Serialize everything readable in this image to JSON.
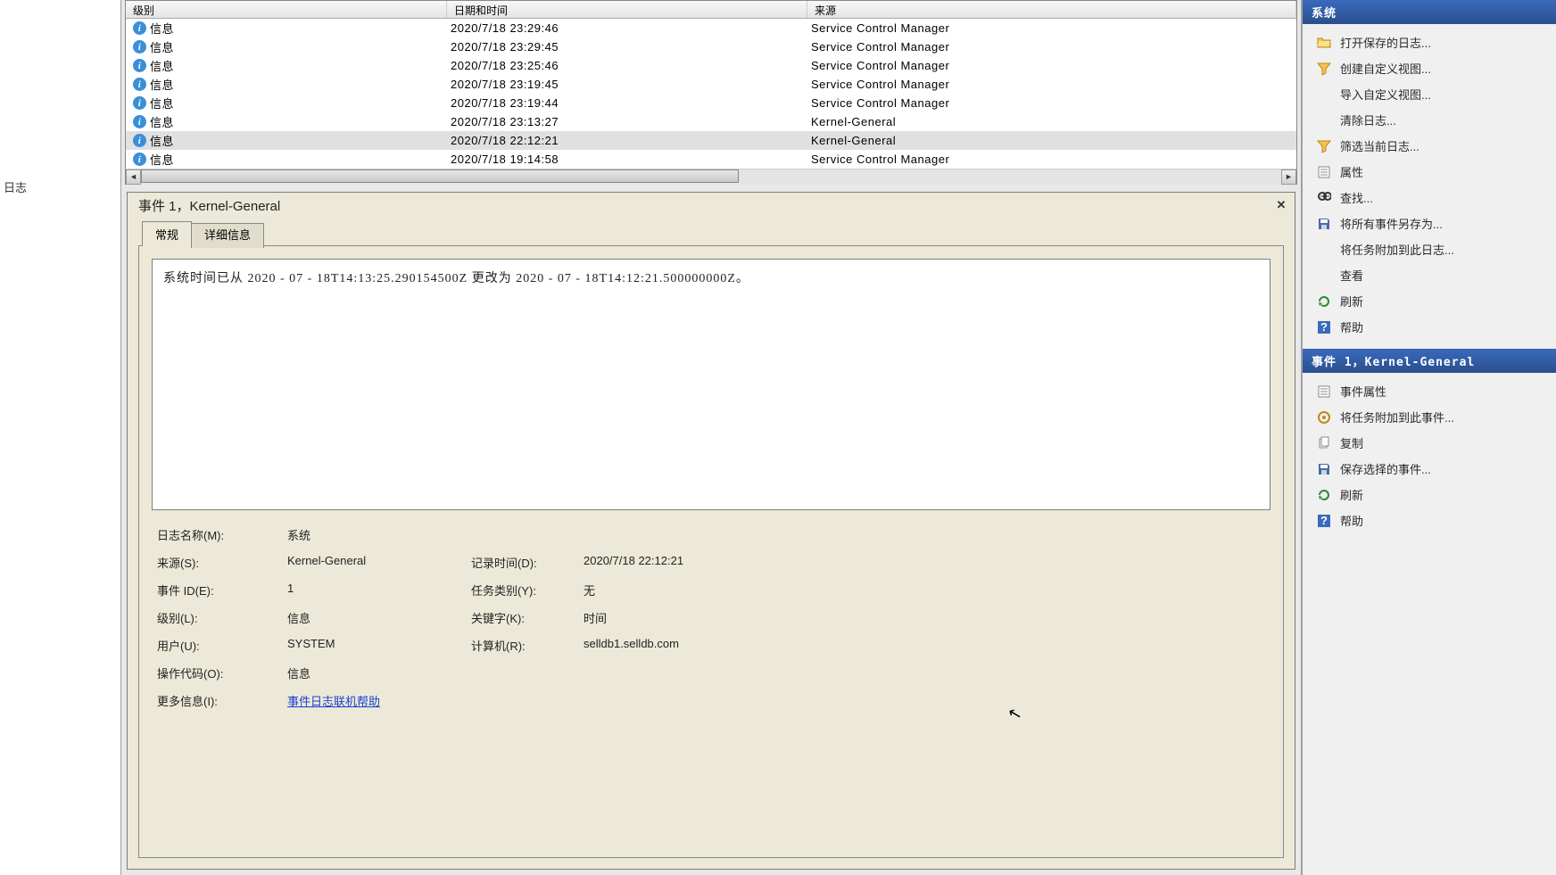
{
  "leftSidebar": {
    "label": "日志"
  },
  "grid": {
    "headers": {
      "level": "级别",
      "date": "日期和时间",
      "source": "来源"
    },
    "rows": [
      {
        "level": "信息",
        "date": "2020/7/18 23:29:46",
        "source": "Service Control Manager",
        "selected": false
      },
      {
        "level": "信息",
        "date": "2020/7/18 23:29:45",
        "source": "Service Control Manager",
        "selected": false
      },
      {
        "level": "信息",
        "date": "2020/7/18 23:25:46",
        "source": "Service Control Manager",
        "selected": false
      },
      {
        "level": "信息",
        "date": "2020/7/18 23:19:45",
        "source": "Service Control Manager",
        "selected": false
      },
      {
        "level": "信息",
        "date": "2020/7/18 23:19:44",
        "source": "Service Control Manager",
        "selected": false
      },
      {
        "level": "信息",
        "date": "2020/7/18 23:13:27",
        "source": "Kernel-General",
        "selected": false
      },
      {
        "level": "信息",
        "date": "2020/7/18 22:12:21",
        "source": "Kernel-General",
        "selected": true
      },
      {
        "level": "信息",
        "date": "2020/7/18 19:14:58",
        "source": "Service Control Manager",
        "selected": false
      }
    ]
  },
  "detail": {
    "title": "事件 1，Kernel-General",
    "tabs": {
      "general": "常规",
      "details": "详细信息"
    },
    "description": "系统时间已从 ‎2020‎ - ‎07‎ - ‎18T14:13:25.290154500Z 更改为 ‎2020‎ - ‎07‎ - ‎18T14:12:21.500000000Z。",
    "fields": {
      "logNameLabel": "日志名称(M):",
      "logName": "系统",
      "sourceLabel": "来源(S):",
      "source": "Kernel-General",
      "recordedLabel": "记录时间(D):",
      "recorded": "2020/7/18 22:12:21",
      "eventIdLabel": "事件 ID(E):",
      "eventId": "1",
      "taskCatLabel": "任务类别(Y):",
      "taskCat": "无",
      "levelLabel": "级别(L):",
      "level": "信息",
      "keywordsLabel": "关键字(K):",
      "keywords": "时间",
      "userLabel": "用户(U):",
      "user": "SYSTEM",
      "computerLabel": "计算机(R):",
      "computer": "selldb1.selldb.com",
      "opcodeLabel": "操作代码(O):",
      "opcode": "信息",
      "moreInfoLabel": "更多信息(I):",
      "moreInfoLink": "事件日志联机帮助"
    }
  },
  "actions": {
    "header1": "系统",
    "items1": [
      {
        "icon": "folder-open",
        "label": "打开保存的日志..."
      },
      {
        "icon": "funnel-new",
        "label": "创建自定义视图..."
      },
      {
        "icon": "blank",
        "label": "导入自定义视图..."
      },
      {
        "icon": "blank",
        "label": "清除日志..."
      },
      {
        "icon": "funnel",
        "label": "筛选当前日志..."
      },
      {
        "icon": "props",
        "label": "属性"
      },
      {
        "icon": "find",
        "label": "查找..."
      },
      {
        "icon": "save",
        "label": "将所有事件另存为..."
      },
      {
        "icon": "blank",
        "label": "将任务附加到此日志..."
      },
      {
        "icon": "blank",
        "label": "查看"
      },
      {
        "icon": "refresh",
        "label": "刷新"
      },
      {
        "icon": "help",
        "label": "帮助"
      }
    ],
    "header2": "事件 1，Kernel-General",
    "items2": [
      {
        "icon": "props",
        "label": "事件属性"
      },
      {
        "icon": "attach",
        "label": "将任务附加到此事件..."
      },
      {
        "icon": "copy",
        "label": "复制"
      },
      {
        "icon": "save",
        "label": "保存选择的事件..."
      },
      {
        "icon": "refresh",
        "label": "刷新"
      },
      {
        "icon": "help",
        "label": "帮助"
      }
    ]
  }
}
